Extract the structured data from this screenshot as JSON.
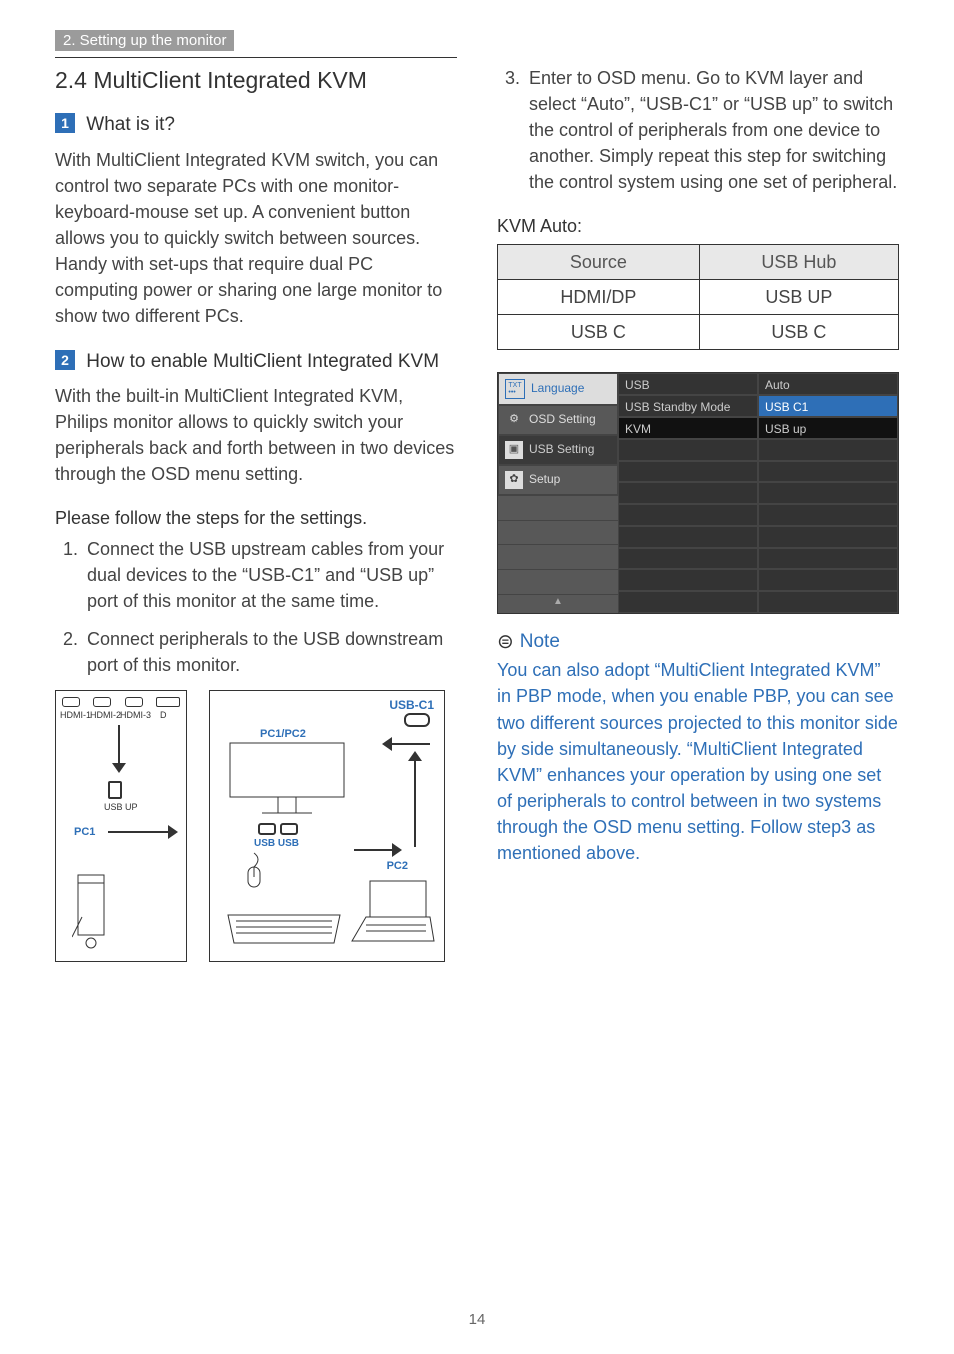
{
  "chapter_tab": "2. Setting up the monitor",
  "section_title": "2.4 MultiClient Integrated KVM",
  "blocks": {
    "b1_title": "What is it?",
    "b1_body": "With MultiClient Integrated KVM switch, you can control two separate PCs with one monitor-keyboard-mouse set up. A convenient button allows you to quickly switch between sources. Handy with set-ups that require dual PC computing power or sharing one large monitor to show two different PCs.",
    "b2_title": "How to enable MultiClient Integrated KVM",
    "b2_body": "With the built-in MultiClient Integrated KVM, Philips monitor allows to quickly switch your peripherals back and forth between in two devices through the OSD menu setting.",
    "steps_intro": "Please follow the steps for the settings.",
    "step1": "Connect the USB upstream cables from your dual devices to the “USB-C1” and “USB up” port of this monitor at the same time.",
    "step2": "Connect peripherals to the USB downstream port of this monitor.",
    "step3": "Enter to OSD menu. Go to KVM layer and select “Auto”, “USB-C1” or “USB up” to switch the control of peripherals from one device to another. Simply repeat this step for switching the control system using one set of peripheral."
  },
  "kvm_table": {
    "title": "KVM Auto:",
    "headers": [
      "Source",
      "USB Hub"
    ],
    "rows": [
      [
        "HDMI/DP",
        "USB UP"
      ],
      [
        "USB C",
        "USB C"
      ]
    ]
  },
  "osd": {
    "tabs": [
      "Language",
      "OSD Setting",
      "USB Setting",
      "Setup"
    ],
    "col1": [
      "USB",
      "USB Standby Mode",
      "KVM"
    ],
    "col2": [
      "Auto",
      "USB C1",
      "USB up"
    ]
  },
  "note": {
    "title": "Note",
    "body": "You can also adopt “MultiClient Integrated KVM” in PBP mode, when you enable PBP, you can see two different sources projected to this monitor side by side simultaneously. “MultiClient Integrated KVM” enhances your operation by using one set of peripherals to control between in two systems through the OSD menu setting. Follow step3 as mentioned above."
  },
  "diagram": {
    "hdmi1": "HDMI-1",
    "hdmi2": "HDMI-2",
    "hdmi3": "HDMI-3",
    "dp": "D",
    "usbup": "USB UP",
    "pc1": "PC1",
    "pc2": "PC2",
    "pc12": "PC1/PC2",
    "usbc1": "USB-C1",
    "usbusb": "USB USB"
  },
  "page_number": "14"
}
